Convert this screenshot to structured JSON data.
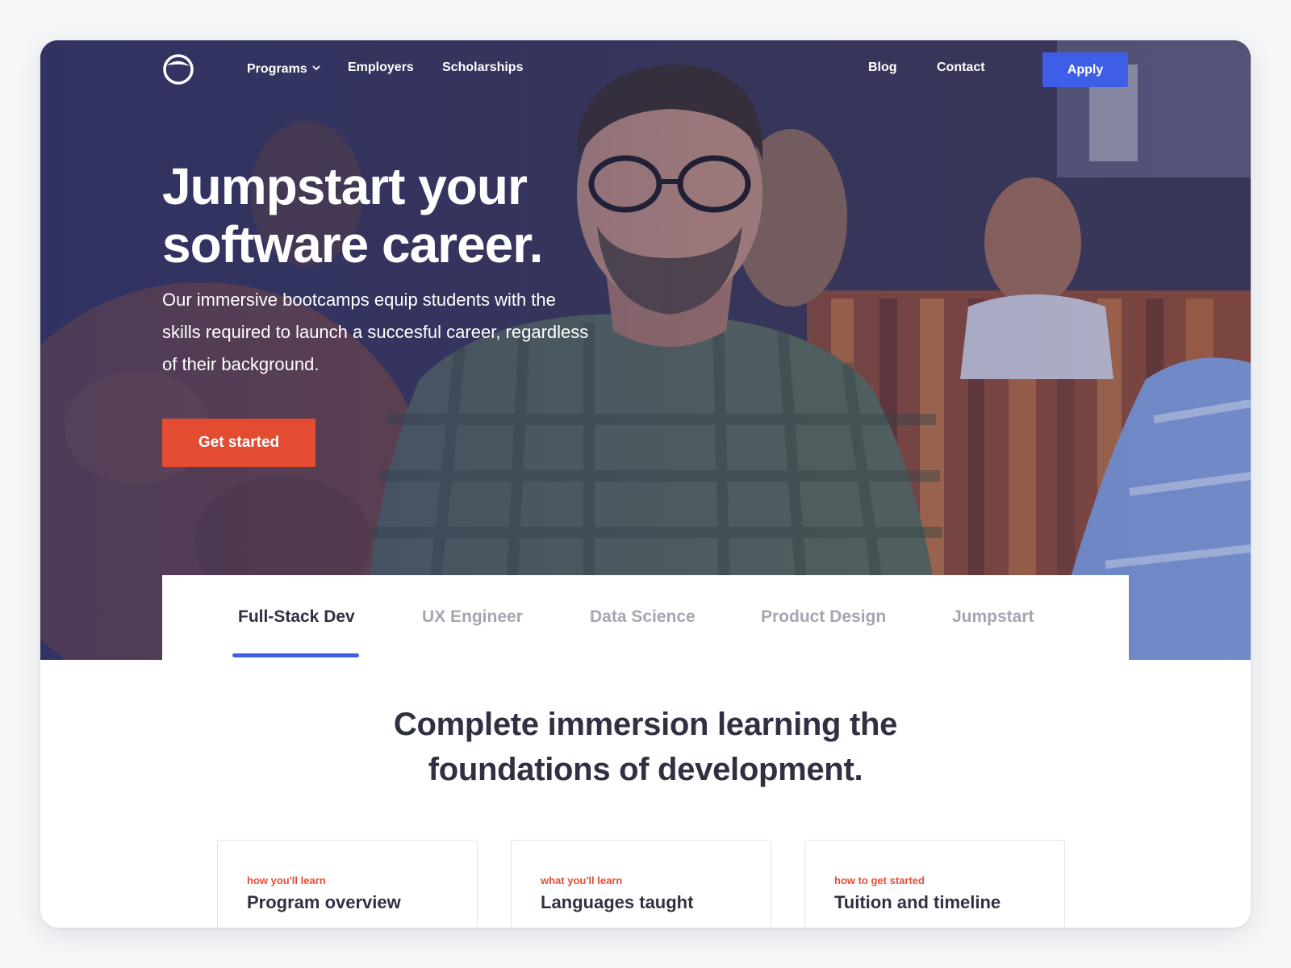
{
  "nav": {
    "logo_icon": "ring-logo-icon",
    "programs_label": "Programs",
    "programs_icon": "chevron-down-icon",
    "employers_label": "Employers",
    "scholarships_label": "Scholarships",
    "blog_label": "Blog",
    "contact_label": "Contact",
    "apply_label": "Apply"
  },
  "hero": {
    "title_line1": "Jumpstart your",
    "title_line2": "software career.",
    "subtitle": "Our immersive bootcamps equip students with the skills required to launch a succesful career, regardless of their background.",
    "cta_label": "Get started"
  },
  "tabs": [
    {
      "label": "Full-Stack Dev",
      "active": true
    },
    {
      "label": "UX Engineer",
      "active": false
    },
    {
      "label": "Data Science",
      "active": false
    },
    {
      "label": "Product Design",
      "active": false
    },
    {
      "label": "Jumpstart",
      "active": false
    }
  ],
  "section": {
    "title_line1": "Complete immersion learning the",
    "title_line2": "foundations of development."
  },
  "cards": [
    {
      "kicker": "how you'll learn",
      "title": "Program overview"
    },
    {
      "kicker": "what you'll learn",
      "title": "Languages taught"
    },
    {
      "kicker": "how to get started",
      "title": "Tuition and timeline"
    }
  ],
  "colors": {
    "primary_blue": "#3f5ee8",
    "accent_orange": "#e44c32",
    "heading_dark": "#2f3142",
    "tab_inactive": "#a4a7b3"
  }
}
